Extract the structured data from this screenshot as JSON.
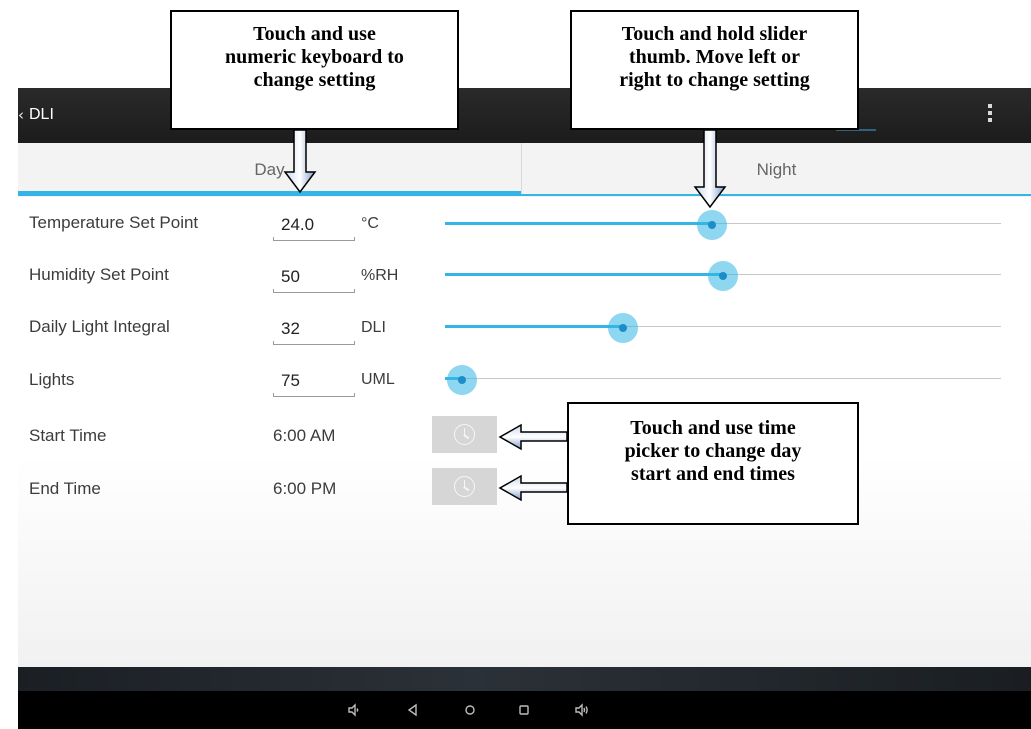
{
  "app": {
    "title": "DLI",
    "back_glyph": "‹"
  },
  "tabs": [
    {
      "label": "Day",
      "selected": true
    },
    {
      "label": "Night",
      "selected": false
    }
  ],
  "settings": [
    {
      "label": "Temperature Set Point",
      "value": "24.0",
      "unit": "°C",
      "slider_fraction": 0.48
    },
    {
      "label": "Humidity Set Point",
      "value": "50",
      "unit": "%RH",
      "slider_fraction": 0.5
    },
    {
      "label": "Daily Light Integral",
      "value": "32",
      "unit": "DLI",
      "slider_fraction": 0.32
    },
    {
      "label": "Lights",
      "value": "75",
      "unit": "UML",
      "slider_fraction": 0.03
    }
  ],
  "times": [
    {
      "label": "Start Time",
      "value": "6:00 AM",
      "icon": "clock-icon"
    },
    {
      "label": "End Time",
      "value": "6:00 PM",
      "icon": "clock-icon"
    }
  ],
  "annotations": {
    "keyboard": [
      "Touch and use",
      "numeric keyboard to",
      "change setting"
    ],
    "slider": [
      "Touch and hold slider",
      "thumb.  Move left or",
      "right to change setting"
    ],
    "time_picker": [
      "Touch and use time",
      "picker to change day",
      "start and end times"
    ]
  },
  "nav": [
    "volume-down-icon",
    "back-icon",
    "home-icon",
    "recents-icon",
    "volume-up-icon"
  ],
  "colors": {
    "accent": "#33b5e5",
    "action_bar": "#222222",
    "nav_bar": "#000000"
  }
}
